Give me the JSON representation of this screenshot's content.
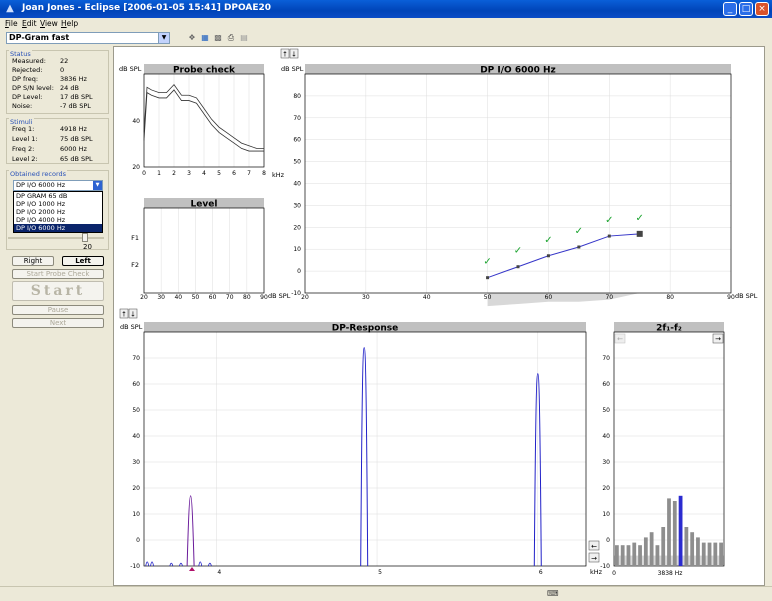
{
  "window": {
    "title": "Joan Jones - Eclipse  [2006-01-05 15:41]  DPOAE20"
  },
  "menu": [
    "File",
    "Edit",
    "View",
    "Help"
  ],
  "toolbar": {
    "protocol": "DP-Gram fast"
  },
  "status": {
    "title": "Status",
    "rows": [
      {
        "label": "Measured:",
        "value": "22"
      },
      {
        "label": "Rejected:",
        "value": "0"
      },
      {
        "label": "DP freq:",
        "value": "3836 Hz"
      },
      {
        "label": "DP S/N level:",
        "value": "24 dB"
      },
      {
        "label": "DP Level:",
        "value": "17 dB SPL"
      },
      {
        "label": "Noise:",
        "value": "-7 dB SPL"
      }
    ]
  },
  "stimuli": {
    "title": "Stimuli",
    "rows": [
      {
        "label": "Freq 1:",
        "value": "4918 Hz"
      },
      {
        "label": "Level 1:",
        "value": "75 dB SPL"
      },
      {
        "label": "Freq 2:",
        "value": "6000 Hz"
      },
      {
        "label": "Level 2:",
        "value": "65 dB SPL"
      }
    ]
  },
  "obtained": {
    "title": "Obtained records",
    "selected": "DP I/O 6000 Hz",
    "options": [
      "DP GRAM 65 dB",
      "DP I/O 1000 Hz",
      "DP I/O 2000 Hz",
      "DP I/O 4000 Hz",
      "DP I/O 6000 Hz"
    ],
    "selected_index": 4,
    "slider_value": "20"
  },
  "buttons": {
    "right": "Right",
    "left": "Left",
    "start_probe": "Start Probe Check",
    "start": "Start",
    "pause": "Pause",
    "next": "Next"
  },
  "charts": {
    "unit": "dB SPL",
    "khz": "kHz",
    "probe": {
      "title": "Probe check",
      "yticks": [
        "40",
        "20"
      ],
      "xticks": [
        "0",
        "1",
        "2",
        "3",
        "4",
        "5",
        "6",
        "7",
        "8"
      ]
    },
    "level": {
      "title": "Level",
      "rows": [
        "F1",
        "F2"
      ],
      "xticks": [
        "20",
        "30",
        "40",
        "50",
        "60",
        "70",
        "80",
        "90"
      ]
    },
    "io": {
      "title": "DP I/O 6000 Hz",
      "yticks": [
        "80",
        "70",
        "60",
        "50",
        "40",
        "30",
        "20",
        "10",
        "0",
        "-10"
      ],
      "xticks": [
        "20",
        "30",
        "40",
        "50",
        "60",
        "70",
        "80",
        "90"
      ]
    },
    "resp": {
      "title": "DP-Response",
      "yticks": [
        "70",
        "60",
        "50",
        "40",
        "30",
        "20",
        "10",
        "0",
        "-10"
      ],
      "xticks": [
        "4",
        "5",
        "6"
      ]
    },
    "fdp": {
      "title": "2f₁-f₂",
      "yticks": [
        "70",
        "60",
        "50",
        "40",
        "30",
        "20",
        "10",
        "0",
        "-10"
      ],
      "xticks": [
        "0",
        "3838 Hz"
      ]
    }
  },
  "chart_data": [
    {
      "type": "line",
      "title": "Probe check",
      "xlabel": "kHz",
      "ylabel": "dB SPL",
      "xlim": [
        0,
        8
      ],
      "ylim": [
        20,
        55
      ],
      "series": [
        {
          "x": [
            0,
            0.2,
            0.5,
            1,
            1.5,
            2,
            2.5,
            3,
            3.5,
            4,
            4.5,
            5,
            5.5,
            6,
            6.5,
            7,
            7.5,
            8
          ],
          "values": [
            30,
            48,
            47,
            46,
            46,
            49,
            45,
            45,
            44,
            40,
            36,
            33,
            31,
            29,
            27,
            26,
            26,
            26
          ]
        },
        {
          "x": [
            0,
            0.2,
            0.5,
            1,
            1.5,
            2,
            2.5,
            3,
            3.5,
            4,
            4.5,
            5,
            5.5,
            6,
            6.5,
            7,
            7.5,
            8
          ],
          "values": [
            33,
            50,
            49,
            48,
            48,
            51,
            47,
            47,
            46,
            42,
            38,
            35,
            33,
            31,
            29,
            28,
            27,
            27
          ]
        }
      ]
    },
    {
      "type": "line",
      "title": "DP I/O 6000 Hz",
      "ylabel": "dB SPL",
      "xlim": [
        20,
        90
      ],
      "ylim": [
        -10,
        90
      ],
      "series": [
        {
          "x": [
            50,
            55,
            60,
            65,
            70,
            75
          ],
          "values": [
            -3,
            2,
            7,
            11,
            16,
            17
          ]
        }
      ],
      "noise_floor": {
        "x": [
          50,
          55,
          60,
          65,
          70,
          75
        ],
        "values": [
          -16,
          -15,
          -14,
          -14,
          -13,
          -10
        ]
      },
      "accepted_points": [
        50,
        55,
        60,
        65,
        70,
        75
      ]
    },
    {
      "type": "line",
      "title": "DP-Response",
      "xlabel": "kHz",
      "ylabel": "dB SPL",
      "xlim": [
        3.55,
        6.3
      ],
      "ylim": [
        -10,
        80
      ],
      "peaks": [
        {
          "x": 3.84,
          "value": 17
        },
        {
          "x": 4.92,
          "value": 74
        },
        {
          "x": 6.0,
          "value": 64
        }
      ]
    },
    {
      "type": "bar",
      "title": "2f₁-f₂",
      "ylabel": "dB SPL",
      "ylim": [
        -10,
        80
      ],
      "values": [
        -2,
        -2,
        -2,
        -1,
        -2,
        1,
        3,
        -2,
        5,
        16,
        15,
        17,
        5,
        3,
        1,
        -1,
        -1,
        -1,
        -1
      ],
      "highlight_index": 11,
      "noise_level": -6
    }
  ]
}
